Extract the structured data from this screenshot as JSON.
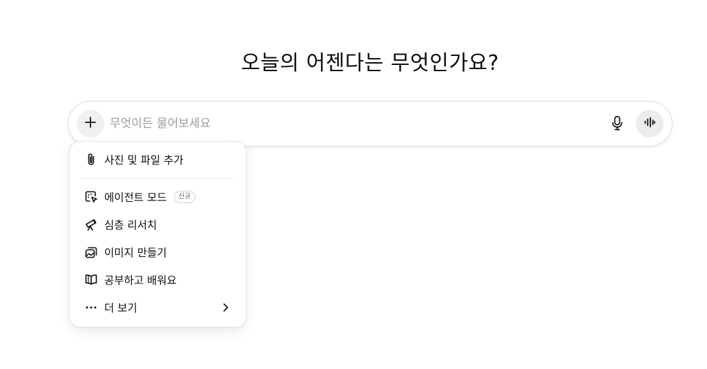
{
  "headline": "오늘의 어젠다는 무엇인가요?",
  "composer": {
    "placeholder": "무엇이든 물어보세요",
    "plus_icon": "plus-icon",
    "mic_icon": "microphone-icon",
    "voice_icon": "voice-waveform-icon"
  },
  "menu": {
    "items": [
      {
        "label": "사진 및 파일 추가",
        "icon": "paperclip-icon"
      },
      {
        "label": "에이전트 모드",
        "icon": "agent-cursor-icon",
        "badge": "신규"
      },
      {
        "label": "심층 리서치",
        "icon": "telescope-icon"
      },
      {
        "label": "이미지 만들기",
        "icon": "image-stack-icon"
      },
      {
        "label": "공부하고 배워요",
        "icon": "open-book-icon"
      },
      {
        "label": "더 보기",
        "icon": "more-dots-icon"
      }
    ]
  }
}
